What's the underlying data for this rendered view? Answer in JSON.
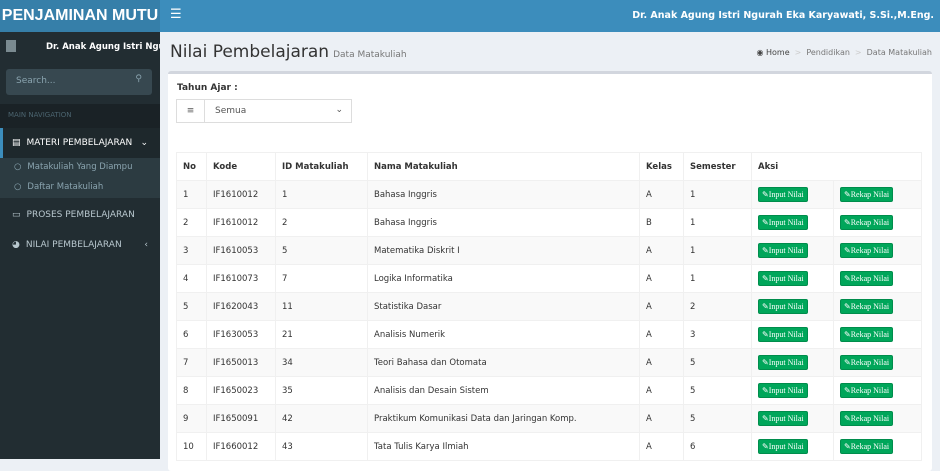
{
  "app": {
    "logo": "PENJAMINAN MUTU",
    "user": "Dr. Anak Agung Istri Ngurah Eka Karyawati, S.Si.,M.Eng."
  },
  "sidebar": {
    "user_name": "Dr. Anak Agung Istri Ngurah Eka Karyawati, S.Si.,M.Eng.",
    "search_placeholder": "Search...",
    "nav_header": "MAIN NAVIGATION",
    "items": [
      {
        "label": "MATERI PEMBELAJARAN",
        "icon": "book-icon"
      },
      {
        "label": "PROSES PEMBELAJARAN",
        "icon": "laptop-icon"
      },
      {
        "label": "NILAI PEMBELAJARAN",
        "icon": "pie-chart-icon"
      }
    ],
    "subitems": [
      {
        "label": "Matakuliah Yang Diampu"
      },
      {
        "label": "Daftar Matakuliah"
      }
    ]
  },
  "page": {
    "title": "Nilai Pembelajaran",
    "subtitle": "Data Matakuliah",
    "breadcrumb": [
      "Home",
      "Pendidikan",
      "Data Matakuliah"
    ]
  },
  "filter": {
    "label": "Tahun Ajar :",
    "value": "Semua"
  },
  "table": {
    "headers": [
      "No",
      "Kode",
      "ID Matakuliah",
      "Nama Matakuliah",
      "Kelas",
      "Semester",
      "Aksi"
    ],
    "input_label": "Input Nilai",
    "rekap_label": "Rekap Nilai",
    "rows": [
      [
        "1",
        "IF1610012",
        "1",
        "Bahasa Inggris",
        "A",
        "1"
      ],
      [
        "2",
        "IF1610012",
        "2",
        "Bahasa Inggris",
        "B",
        "1"
      ],
      [
        "3",
        "IF1610053",
        "5",
        "Matematika Diskrit I",
        "A",
        "1"
      ],
      [
        "4",
        "IF1610073",
        "7",
        "Logika Informatika",
        "A",
        "1"
      ],
      [
        "5",
        "IF1620043",
        "11",
        "Statistika Dasar",
        "A",
        "2"
      ],
      [
        "6",
        "IF1630053",
        "21",
        "Analisis Numerik",
        "A",
        "3"
      ],
      [
        "7",
        "IF1650013",
        "34",
        "Teori Bahasa dan Otomata",
        "A",
        "5"
      ],
      [
        "8",
        "IF1650023",
        "35",
        "Analisis dan Desain Sistem",
        "A",
        "5"
      ],
      [
        "9",
        "IF1650091",
        "42",
        "Praktikum Komunikasi Data dan Jaringan Komp.",
        "A",
        "5"
      ],
      [
        "10",
        "IF1660012",
        "43",
        "Tata Tulis Karya Ilmiah",
        "A",
        "6"
      ]
    ]
  }
}
